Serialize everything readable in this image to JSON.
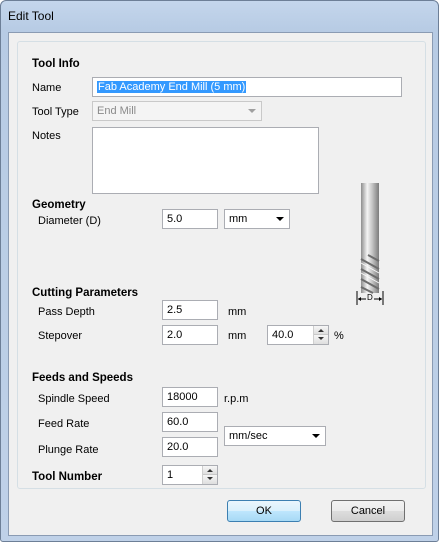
{
  "window": {
    "title": "Edit Tool"
  },
  "tool_info": {
    "header": "Tool Info",
    "name_label": "Name",
    "name_value": "Fab Academy End Mill (5 mm)",
    "tool_type_label": "Tool Type",
    "tool_type_value": "End Mill",
    "notes_label": "Notes",
    "notes_value": ""
  },
  "geometry": {
    "header": "Geometry",
    "diameter_label": "Diameter (D)",
    "diameter_value": "5.0",
    "units_value": "mm",
    "diagram_label": "D"
  },
  "cutting": {
    "header": "Cutting Parameters",
    "pass_depth_label": "Pass Depth",
    "pass_depth_value": "2.5",
    "pass_depth_unit": "mm",
    "stepover_label": "Stepover",
    "stepover_value": "2.0",
    "stepover_unit": "mm",
    "stepover_percent_value": "40.0",
    "percent_unit": "%"
  },
  "feeds": {
    "header": "Feeds and Speeds",
    "spindle_label": "Spindle Speed",
    "spindle_value": "18000",
    "spindle_unit": "r.p.m",
    "feed_label": "Feed Rate",
    "feed_value": "60.0",
    "plunge_label": "Plunge Rate",
    "plunge_value": "20.0",
    "rate_units_value": "mm/sec"
  },
  "tool_number": {
    "label": "Tool Number",
    "value": "1"
  },
  "buttons": {
    "ok": "OK",
    "cancel": "Cancel"
  }
}
